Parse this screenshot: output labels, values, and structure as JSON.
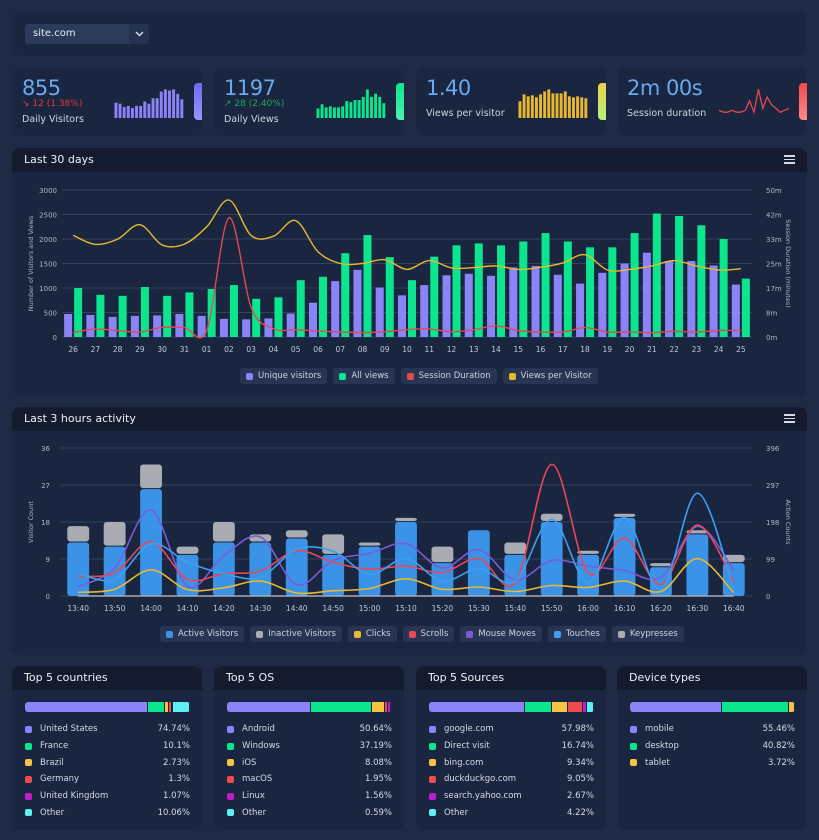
{
  "site_selector": {
    "value": "site.com",
    "icon": "chevron-down-icon"
  },
  "stats": [
    {
      "value": "855",
      "change": "12 (1.38%)",
      "change_dir": "down",
      "label": "Daily Visitors",
      "color": "#8b84f8",
      "spark_type": "bar",
      "spark": [
        14,
        13,
        10,
        11,
        9,
        11,
        11,
        15,
        13,
        18,
        18,
        24,
        26,
        25,
        26,
        22,
        17
      ]
    },
    {
      "value": "1197",
      "change": "28 (2.40%)",
      "change_dir": "up",
      "label": "Daily Views",
      "color": "#0be58e",
      "spark_type": "bar",
      "spark": [
        9,
        13,
        10,
        11,
        10,
        10,
        11,
        16,
        15,
        17,
        17,
        20,
        27,
        20,
        23,
        20,
        14
      ]
    },
    {
      "value": "1.40",
      "change": "",
      "change_dir": "",
      "label": "Views per visitor",
      "color": "#e9b831",
      "spark_type": "bar",
      "spark": [
        17,
        24,
        22,
        23,
        21,
        24,
        27,
        29,
        25,
        25,
        25,
        27,
        22,
        21,
        22,
        21,
        20
      ]
    },
    {
      "value": "2m 00s",
      "change": "",
      "change_dir": "",
      "label": "Session duration",
      "color": "#e24a52",
      "spark_type": "line",
      "spark": [
        3,
        2,
        2,
        3,
        2,
        2,
        3,
        8,
        2,
        14,
        4,
        10,
        6,
        4,
        2,
        3,
        4
      ]
    }
  ],
  "panel30": {
    "title": "Last 30 days",
    "menu_icon": "hamburger-menu-icon"
  },
  "panel3h": {
    "title": "Last 3 hours activity",
    "menu_icon": "hamburger-menu-icon"
  },
  "chart_data": [
    {
      "type": "bar",
      "title": "Last 30 days",
      "categories": [
        "26",
        "27",
        "28",
        "29",
        "30",
        "31",
        "01",
        "02",
        "03",
        "04",
        "05",
        "06",
        "07",
        "08",
        "09",
        "10",
        "11",
        "12",
        "13",
        "14",
        "15",
        "16",
        "17",
        "18",
        "19",
        "20",
        "21",
        "22",
        "23",
        "24",
        "25"
      ],
      "ylabel": "Number of Visitors and Views",
      "ylabel_right": "Session Duration (minutes)",
      "ylim": [
        0,
        3000
      ],
      "yticks": [
        0,
        500,
        1000,
        1500,
        2000,
        2500,
        3000
      ],
      "yticks_right": [
        "0m",
        "8m",
        "17m",
        "25m",
        "33m",
        "42m",
        "50m"
      ],
      "grid": true,
      "legend": "bottom",
      "series": [
        {
          "name": "Unique visitors",
          "type": "bar",
          "color": "#8b84f8",
          "values": [
            470,
            450,
            410,
            430,
            440,
            470,
            430,
            370,
            360,
            380,
            480,
            700,
            1140,
            1370,
            1010,
            850,
            1060,
            1260,
            1290,
            1250,
            1420,
            1450,
            1270,
            1090,
            1310,
            1500,
            1720,
            1550,
            1550,
            1460,
            1070
          ]
        },
        {
          "name": "All views",
          "type": "bar",
          "color": "#0be58e",
          "values": [
            1000,
            860,
            840,
            1020,
            840,
            910,
            980,
            1060,
            780,
            810,
            1160,
            1230,
            1710,
            2080,
            1630,
            1160,
            1640,
            1870,
            1910,
            1870,
            1950,
            2120,
            1950,
            1830,
            1830,
            2120,
            2520,
            2470,
            2280,
            2000,
            1190
          ]
        },
        {
          "name": "Session Duration",
          "type": "line",
          "axis": "right",
          "color": "#e24a52",
          "values": [
            1.5,
            2.7,
            2.2,
            1.7,
            3.3,
            3.2,
            2.3,
            40.5,
            10,
            2.8,
            2.5,
            2,
            1.7,
            1.5,
            1.8,
            2.5,
            2.7,
            1.8,
            2.5,
            3.8,
            2.2,
            1.7,
            1.7,
            3.2,
            1.7,
            1.7,
            1.5,
            1.9,
            1.7,
            2.2,
            2.2
          ]
        },
        {
          "name": "Views per Visitor",
          "type": "line",
          "axis": "right",
          "color": "#e9b831",
          "values": [
            34.6,
            31.5,
            33.3,
            38.2,
            31.3,
            31.6,
            37.5,
            46.6,
            34.5,
            34.3,
            39.6,
            29,
            25,
            25,
            26.3,
            23,
            26,
            23.5,
            23.6,
            24.2,
            23,
            23.7,
            25.2,
            28,
            22.8,
            23,
            24.2,
            26,
            24.2,
            22.8,
            23.2
          ]
        }
      ]
    },
    {
      "type": "bar",
      "title": "Last 3 hours activity",
      "categories": [
        "13:40",
        "13:50",
        "14:00",
        "14:10",
        "14:20",
        "14:30",
        "14:40",
        "14:50",
        "15:00",
        "15:10",
        "15:20",
        "15:30",
        "15:40",
        "15:50",
        "16:00",
        "16:10",
        "16:20",
        "16:30",
        "16:40"
      ],
      "ylabel": "Visitor Count",
      "ylabel_right": "Action Counts",
      "ylim": [
        0,
        36
      ],
      "ylim_right": [
        0,
        396
      ],
      "yticks": [
        0,
        9,
        18,
        27,
        36
      ],
      "yticks_right": [
        0,
        99,
        198,
        297,
        396
      ],
      "stacked": true,
      "grid": true,
      "legend": "bottom",
      "series": [
        {
          "name": "Active Visitors",
          "type": "bar",
          "color": "#3b93e8",
          "values": [
            13,
            12,
            26,
            10,
            13,
            13,
            14,
            10,
            12,
            18,
            8,
            16,
            10,
            18,
            10,
            19,
            7,
            15,
            8
          ]
        },
        {
          "name": "Inactive Visitors",
          "type": "bar",
          "color": "#a9acb3",
          "values": [
            4,
            6,
            6,
            2,
            5,
            2,
            2,
            5,
            1,
            1,
            4,
            0,
            3,
            2,
            1,
            1,
            1,
            1,
            2
          ]
        },
        {
          "name": "Clicks",
          "type": "line",
          "axis": "right",
          "color": "#e9b831",
          "values": [
            10,
            18,
            70,
            17,
            22,
            40,
            8,
            14,
            20,
            46,
            18,
            24,
            12,
            28,
            23,
            40,
            12,
            100,
            9
          ]
        },
        {
          "name": "Scrolls",
          "type": "line",
          "axis": "right",
          "color": "#e8485a",
          "values": [
            53,
            62,
            145,
            45,
            60,
            67,
            121,
            90,
            72,
            80,
            63,
            100,
            36,
            352,
            62,
            155,
            31,
            190,
            38
          ]
        },
        {
          "name": "Mouse Moves",
          "type": "line",
          "axis": "right",
          "color": "#7b5bd8",
          "values": [
            25,
            75,
            230,
            26,
            108,
            158,
            30,
            95,
            114,
            140,
            75,
            124,
            43,
            95,
            80,
            68,
            50,
            186,
            70
          ]
        },
        {
          "name": "Touches",
          "type": "line",
          "axis": "right",
          "color": "#3ba0f0",
          "values": [
            60,
            45,
            140,
            90,
            60,
            50,
            125,
            120,
            58,
            100,
            40,
            73,
            40,
            205,
            36,
            210,
            18,
            275,
            20
          ]
        },
        {
          "name": "Keypresses",
          "type": "line",
          "axis": "right",
          "color": "#a9acb3",
          "values": []
        }
      ]
    }
  ],
  "breakdowns": [
    {
      "title": "Top 5 countries",
      "items": [
        {
          "label": "United States",
          "pct": "74.74%",
          "value": 74.74,
          "color": "#8b84f8"
        },
        {
          "label": "France",
          "pct": "10.1%",
          "value": 10.1,
          "color": "#0be58e"
        },
        {
          "label": "Brazil",
          "pct": "2.73%",
          "value": 2.73,
          "color": "#f6c342"
        },
        {
          "label": "Germany",
          "pct": "1.3%",
          "value": 1.3,
          "color": "#f0494e"
        },
        {
          "label": "United Kingdom",
          "pct": "1.07%",
          "value": 1.07,
          "color": "#c11dcb"
        },
        {
          "label": "Other",
          "pct": "10.06%",
          "value": 10.06,
          "color": "#5ef0f2"
        }
      ]
    },
    {
      "title": "Top 5 OS",
      "items": [
        {
          "label": "Android",
          "pct": "50.64%",
          "value": 50.64,
          "color": "#8b84f8"
        },
        {
          "label": "Windows",
          "pct": "37.19%",
          "value": 37.19,
          "color": "#0be58e"
        },
        {
          "label": "iOS",
          "pct": "8.08%",
          "value": 8.08,
          "color": "#f6c342"
        },
        {
          "label": "macOS",
          "pct": "1.95%",
          "value": 1.95,
          "color": "#f0494e"
        },
        {
          "label": "Linux",
          "pct": "1.56%",
          "value": 1.56,
          "color": "#c11dcb"
        },
        {
          "label": "Other",
          "pct": "0.59%",
          "value": 0.59,
          "color": "#5ef0f2"
        }
      ]
    },
    {
      "title": "Top 5 Sources",
      "items": [
        {
          "label": "google.com",
          "pct": "57.98%",
          "value": 57.98,
          "color": "#8b84f8"
        },
        {
          "label": "Direct visit",
          "pct": "16.74%",
          "value": 16.74,
          "color": "#0be58e"
        },
        {
          "label": "bing.com",
          "pct": "9.34%",
          "value": 9.34,
          "color": "#f6c342"
        },
        {
          "label": "duckduckgo.com",
          "pct": "9.05%",
          "value": 9.05,
          "color": "#f0494e"
        },
        {
          "label": "search.yahoo.com",
          "pct": "2.67%",
          "value": 2.67,
          "color": "#c11dcb"
        },
        {
          "label": "Other",
          "pct": "4.22%",
          "value": 4.22,
          "color": "#5ef0f2"
        }
      ]
    },
    {
      "title": "Device types",
      "items": [
        {
          "label": "mobile",
          "pct": "55.46%",
          "value": 55.46,
          "color": "#8b84f8"
        },
        {
          "label": "desktop",
          "pct": "40.82%",
          "value": 40.82,
          "color": "#0be58e"
        },
        {
          "label": "tablet",
          "pct": "3.72%",
          "value": 3.72,
          "color": "#f6c342"
        }
      ]
    }
  ]
}
